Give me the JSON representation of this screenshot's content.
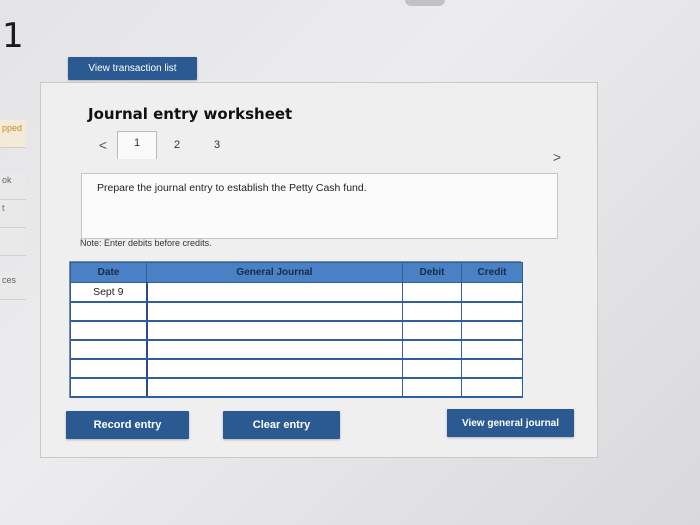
{
  "page": {
    "question_number": "1",
    "left_rail": [
      "pped",
      "ok",
      "t",
      "",
      "ces"
    ]
  },
  "toolbar": {
    "view_transaction_list": "View transaction list"
  },
  "worksheet": {
    "title": "Journal entry worksheet",
    "tabs": [
      "1",
      "2",
      "3"
    ],
    "active_tab": "1",
    "prev_arrow": "<",
    "next_arrow": ">",
    "prompt": "Prepare the journal entry to establish the Petty Cash fund.",
    "note": "Note: Enter debits before credits."
  },
  "journal_table": {
    "headers": [
      "Date",
      "General Journal",
      "Debit",
      "Credit"
    ],
    "rows": [
      [
        "Sept 9",
        "",
        "",
        ""
      ],
      [
        "",
        "",
        "",
        ""
      ],
      [
        "",
        "",
        "",
        ""
      ],
      [
        "",
        "",
        "",
        ""
      ],
      [
        "",
        "",
        "",
        ""
      ],
      [
        "",
        "",
        "",
        ""
      ]
    ]
  },
  "actions": {
    "record_entry": "Record entry",
    "clear_entry": "Clear entry",
    "view_general_journal": "View general journal"
  },
  "colors": {
    "button_bg": "#2a5a91",
    "table_header_bg": "#4a80c4",
    "status_accent": "#c88a2a"
  }
}
